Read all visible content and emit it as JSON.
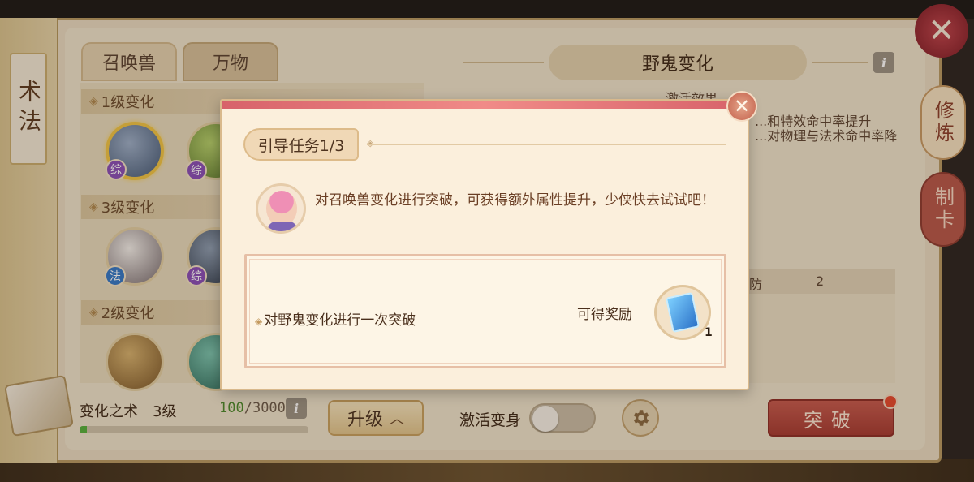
{
  "left_tab": "术法",
  "tabs": [
    "召唤兽",
    "万物"
  ],
  "levels": [
    "1级变化",
    "3级变化",
    "2级变化"
  ],
  "badges": {
    "zong": "综",
    "fa": "法"
  },
  "form": {
    "title": "野鬼变化",
    "effect_header": "激活效果",
    "effect_line1": "...和特效命中率提升",
    "effect_line2": "...对物理与法术命中率降",
    "stat_label": "防",
    "stat_value": "2"
  },
  "right_tabs": {
    "xiulian": "修炼",
    "zhika": "制卡"
  },
  "bottom": {
    "skill_name": "变化之术",
    "skill_level": "3级",
    "exp_current": "100",
    "exp_max": "/3000",
    "exp_fraction": 0.033,
    "upgrade_label": "升级",
    "activate_label": "激活变身",
    "toggle_on": false,
    "break_label": "突破"
  },
  "dialog": {
    "task_tag": "引导任务1/3",
    "guide_text": "对召唤兽变化进行突破，可获得额外属性提升，少侠快去试试吧！",
    "task_desc": "对野鬼变化进行一次突破",
    "reward_label": "可得奖励",
    "reward_count": "1"
  },
  "colors": {
    "accent_red": "#a63b32",
    "exp_green": "#55b13c",
    "dialog_bar": "#d7626a"
  },
  "icons": [
    "close-icon",
    "info-icon",
    "gear-icon",
    "chevron-up-icon",
    "book-icon",
    "reward-card-icon"
  ]
}
